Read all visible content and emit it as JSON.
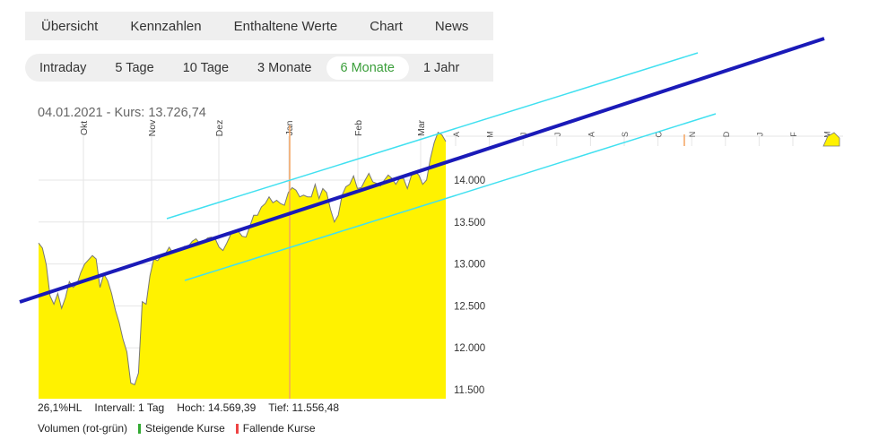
{
  "tabs": [
    "Übersicht",
    "Kennzahlen",
    "Enthaltene Werte",
    "Chart",
    "News"
  ],
  "ranges": [
    "Intraday",
    "5 Tage",
    "10 Tage",
    "3 Monate",
    "6 Monate",
    "1 Jahr"
  ],
  "active_range": "6 Monate",
  "kurs_label": "04.01.2021  -  Kurs: 13.726,74",
  "footer": {
    "hl": "26,1%HL",
    "intervall": "Intervall: 1 Tag",
    "hoch": "Hoch:  14.569,39",
    "tief": "Tief:  11.556,48"
  },
  "legend": {
    "volumen": "Volumen (rot-grün)",
    "steigend": "Steigende Kurse",
    "fallend": "Fallende Kurse"
  },
  "colors": {
    "area_fill": "#fff200",
    "price_line": "#777777",
    "trend_line": "#1a1ab8",
    "channel_line": "#40e0f0",
    "cursor_line": "#f4a460",
    "rising": "#33aa33",
    "falling": "#ee4444"
  },
  "chart_data": {
    "type": "area",
    "title": "",
    "xlabel": "",
    "ylabel": "",
    "y_ticks": [
      11500,
      12000,
      12500,
      13000,
      13500,
      14000
    ],
    "y_tick_labels": [
      "11.500",
      "12.000",
      "12.500",
      "13.000",
      "13.500",
      "14.000"
    ],
    "ylim": [
      11400,
      14650
    ],
    "x_tick_labels": [
      "Okt",
      "Nov",
      "Dez",
      "Jan",
      "Feb",
      "Mar"
    ],
    "future_x_tick_labels": [
      "A",
      "M",
      "J",
      "J",
      "A",
      "S",
      "O",
      "N",
      "D",
      "J",
      "F",
      "M"
    ],
    "series": [
      {
        "values": [
          13250,
          13190,
          12990,
          12620,
          12520,
          12650,
          12470,
          12600,
          12790,
          12720,
          12760,
          12900,
          13000,
          13050,
          13100,
          13060,
          12720,
          12880,
          12800,
          12650,
          12450,
          12300,
          12100,
          11950,
          11580,
          11560,
          11700,
          12550,
          12520,
          12860,
          13060,
          13040,
          13100,
          13120,
          13200,
          13130,
          13150,
          13170,
          13210,
          13210,
          13270,
          13300,
          13240,
          13270,
          13310,
          13320,
          13300,
          13200,
          13160,
          13250,
          13350,
          13400,
          13390,
          13330,
          13320,
          13450,
          13580,
          13580,
          13680,
          13720,
          13800,
          13730,
          13760,
          13720,
          13700,
          13850,
          13910,
          13880,
          13800,
          13820,
          13800,
          13800,
          13950,
          13780,
          13900,
          13850,
          13650,
          13500,
          13580,
          13820,
          13920,
          13950,
          14050,
          13900,
          13910,
          14000,
          14080,
          13980,
          13960,
          13930,
          14000,
          14060,
          14020,
          13950,
          14020,
          14020,
          13900,
          14050,
          14100,
          14060,
          13950,
          14000,
          14260,
          14450,
          14570,
          14540,
          14460
        ]
      }
    ]
  }
}
